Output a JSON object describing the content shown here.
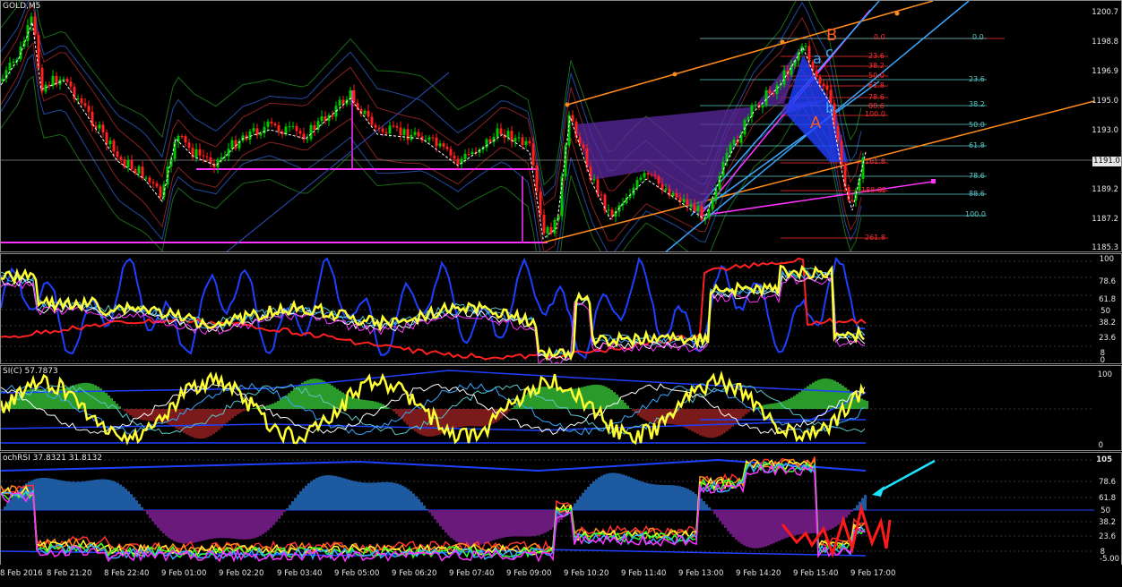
{
  "symbol_label": "GOLD,M5",
  "current_price": "1191.0",
  "colors": {
    "bg": "#000000",
    "candle_up": "#00c800",
    "candle_down": "#ff2020",
    "magenta": "#ff33ff",
    "orange": "#ff8c1a",
    "blue": "#1e5fff",
    "light_blue": "#3aa8ff",
    "yellow": "#ffff33",
    "teal": "#5bc8c8",
    "red_fib": "#ff3030"
  },
  "main_axis": [
    "1200.7",
    "1198.8",
    "1196.9",
    "1195.0",
    "1193.0",
    "1189.2",
    "1187.2",
    "1185.3"
  ],
  "fib_left": [
    "0.0",
    "23.6",
    "38.2",
    "50.0",
    "61.8",
    "78.6",
    "88.6",
    "100.0",
    "161.8",
    "188.82",
    "261.8"
  ],
  "fib_right": [
    "0.0",
    "23.6",
    "38.2",
    "50.0",
    "61.8",
    "78.6",
    "88.6",
    "100.0"
  ],
  "pattern_labels": {
    "B": "B",
    "A": "A",
    "a": "a",
    "c": "c",
    "b": "b"
  },
  "stoch_axis": [
    "100",
    "78.6",
    "61.8",
    "50",
    "38.2",
    "23.6",
    "8",
    "0"
  ],
  "rsi_label": "SI(C) 57.7873",
  "rsi_axis": [
    "100",
    "0"
  ],
  "stochrsi_label": "ochRSI 37.8321 31.8132",
  "stochrsi_axis": [
    "105",
    "78.6",
    "61.8",
    "50",
    "38.2",
    "23.6",
    "8",
    "-5.00"
  ],
  "time_labels": [
    "8 Feb 2016",
    "8 Feb 21:20",
    "8 Feb 22:40",
    "9 Feb 01:00",
    "9 Feb 02:20",
    "9 Feb 03:40",
    "9 Feb 05:00",
    "9 Feb 06:20",
    "9 Feb 07:40",
    "9 Feb 09:00",
    "9 Feb 10:20",
    "9 Feb 11:40",
    "9 Feb 13:00",
    "9 Feb 14:20",
    "9 Feb 15:40",
    "9 Feb 17:00"
  ]
}
